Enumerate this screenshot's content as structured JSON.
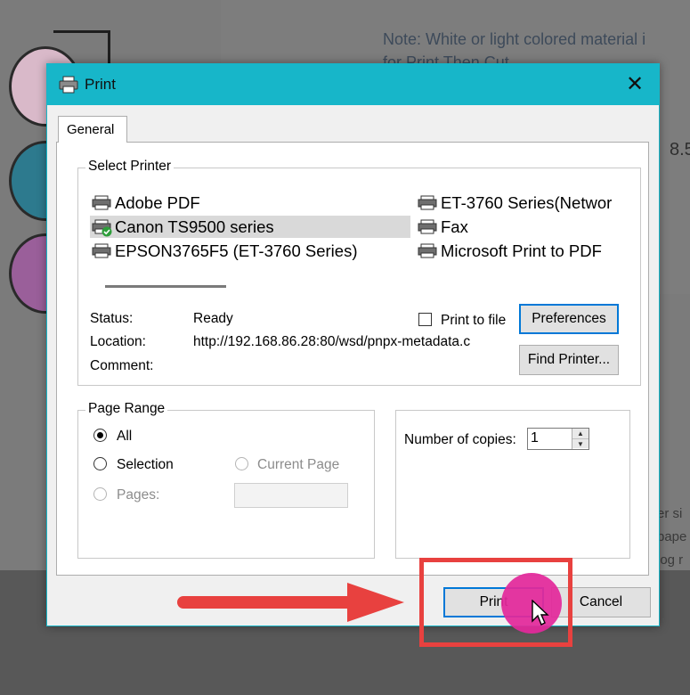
{
  "background": {
    "note_line1": "Note: White or light colored material i",
    "note_line2": "for Print Then Cut",
    "size_value": "8.5",
    "side_texts": [
      "er si",
      "pape",
      "log r"
    ]
  },
  "dialog": {
    "title": "Print",
    "close_symbol": "✕",
    "tab_general": "General",
    "select_printer": {
      "legend": "Select Printer",
      "printers": [
        {
          "name": "Adobe PDF",
          "selected": false,
          "default": false
        },
        {
          "name": "Canon TS9500 series",
          "selected": true,
          "default": true
        },
        {
          "name": "EPSON3765F5 (ET-3760 Series)",
          "selected": false,
          "default": false
        },
        {
          "name": "ET-3760 Series(Networ",
          "selected": false,
          "default": false
        },
        {
          "name": "Fax",
          "selected": false,
          "default": false
        },
        {
          "name": "Microsoft Print to PDF",
          "selected": false,
          "default": false
        }
      ],
      "status_label": "Status:",
      "status_value": "Ready",
      "location_label": "Location:",
      "location_value": "http://192.168.86.28:80/wsd/pnpx-metadata.c",
      "comment_label": "Comment:",
      "comment_value": "",
      "print_to_file_label": "Print to file",
      "print_to_file_checked": false,
      "preferences_button": "Preferences",
      "find_printer_button": "Find Printer..."
    },
    "page_range": {
      "legend": "Page Range",
      "option_all": "All",
      "option_selection": "Selection",
      "option_current_page": "Current Page",
      "option_pages": "Pages:",
      "selected_option": "All",
      "pages_value": ""
    },
    "copies": {
      "label": "Number of copies:",
      "value": "1"
    },
    "print_button": "Print",
    "cancel_button": "Cancel"
  },
  "colors": {
    "titlebar": "#17b6c9",
    "highlight": "#e8413f",
    "click_indicator": "#e3299b"
  }
}
